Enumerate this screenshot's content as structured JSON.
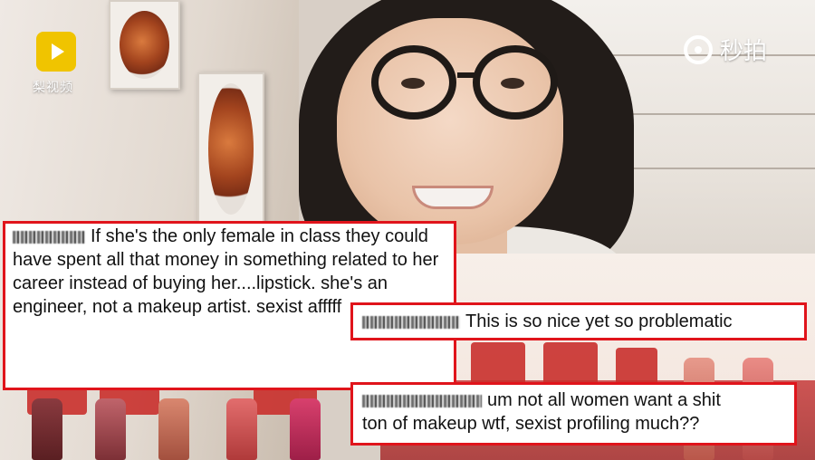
{
  "logos": {
    "pear_video_text": "梨视频",
    "pear_video_icon": "pear-play-icon",
    "miaopai_text": "秒拍",
    "miaopai_icon": "camera-ring-icon"
  },
  "comments": [
    {
      "text": "If she's the only female in class they could have spent all that money in something related to her career instead of buying her....lipstick. she's an engineer, not a makeup artist. sexist afffff"
    },
    {
      "text": "This is so nice yet so problematic"
    },
    {
      "text_line1": "um not all women want a shit",
      "text_line2": "ton of makeup wtf, sexist profiling much??"
    }
  ],
  "colors": {
    "comment_border": "#e0141b",
    "comment_bg": "#ffffff",
    "logo_yellow": "#f0c400"
  }
}
